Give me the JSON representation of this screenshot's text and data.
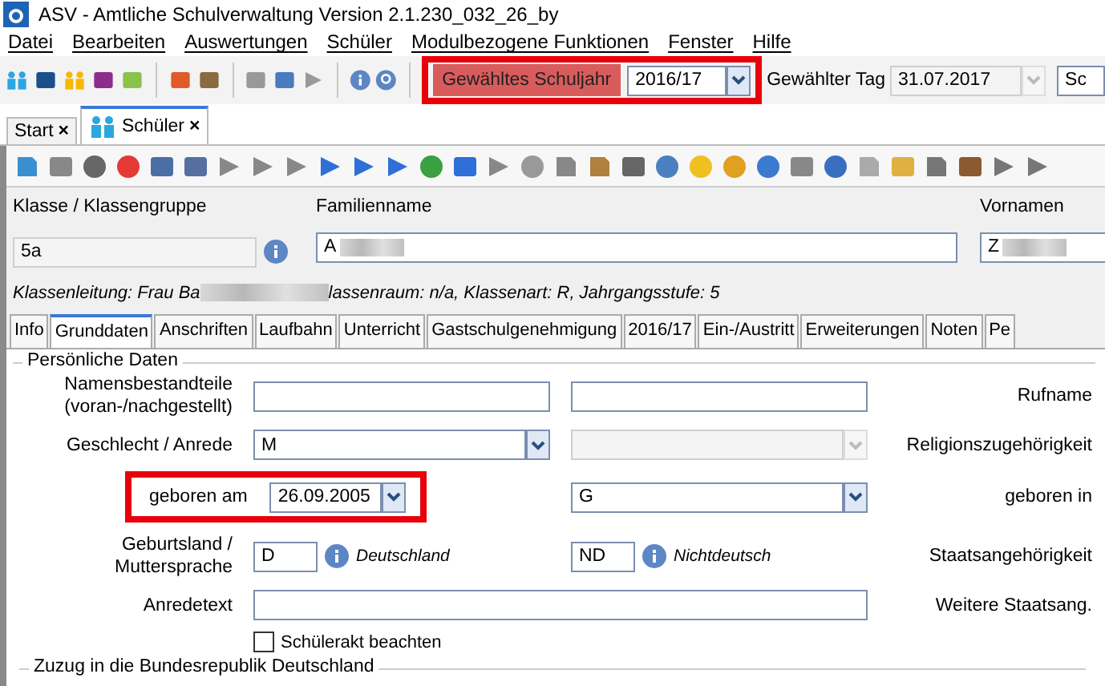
{
  "window": {
    "title": "ASV - Amtliche Schulverwaltung Version 2.1.230_032_26_by"
  },
  "menu": [
    "Datei",
    "Bearbeiten",
    "Auswertungen",
    "Schüler",
    "Modulbezogene Funktionen",
    "Fenster",
    "Hilfe"
  ],
  "toolbar": {
    "schuljahr_label": "Gewähltes Schuljahr",
    "schuljahr_value": "2016/17",
    "tag_label": "Gewählter Tag",
    "tag_value": "31.07.2017",
    "cut_field": "Sc"
  },
  "doc_tabs": [
    {
      "label": "Start",
      "close": "×",
      "selected": false
    },
    {
      "label": "Schüler",
      "close": "×",
      "selected": true
    }
  ],
  "header": {
    "klasse_label": "Klasse / Klassengruppe",
    "klasse_value": "5a",
    "familienname_label": "Familienname",
    "familienname_value": "A",
    "vornamen_label": "Vornamen",
    "vornamen_value": "Z",
    "info_before": "Klassenleitung: Frau Ba",
    "info_after": "lassenraum: n/a, Klassenart: R, Jahrgangsstufe: 5"
  },
  "detail_tabs": [
    {
      "label": "Info",
      "selected": false
    },
    {
      "label": "Grunddaten",
      "selected": true
    },
    {
      "label": "Anschriften",
      "selected": false
    },
    {
      "label": "Laufbahn",
      "selected": false
    },
    {
      "label": "Unterricht",
      "selected": false
    },
    {
      "label": "Gastschulgenehmigung",
      "selected": false
    },
    {
      "label": "2016/17",
      "selected": false
    },
    {
      "label": "Ein-/Austritt",
      "selected": false
    },
    {
      "label": "Erweiterungen",
      "selected": false
    },
    {
      "label": "Noten",
      "selected": false
    },
    {
      "label": "Pe",
      "selected": false
    }
  ],
  "section": {
    "title": "Persönliche Daten",
    "namensbestandteile_label": "Namensbestandteile\n(voran-/nachgestellt)",
    "rufname_label": "Rufname",
    "geschlecht_label": "Geschlecht / Anrede",
    "geschlecht_value": "M",
    "religion_label": "Religionszugehörigkeit",
    "religion_disabled": true,
    "geboren_am_label": "geboren am",
    "geboren_am_value": "26.09.2005",
    "geboren_in_value": "G",
    "geboren_in_label": "geboren in",
    "geburtsland_label": "Geburtsland /\nMuttersprache",
    "geburtsland_value": "D",
    "geburtsland_text": "Deutschland",
    "staat_value": "ND",
    "staat_text": "Nichtdeutsch",
    "staat_label": "Staatsangehörigkeit",
    "anredetext_label": "Anredetext",
    "weitere_label": "Weitere Staatsang.",
    "schuelerakt": {
      "label": "Schülerakt beachten",
      "checked": false
    }
  },
  "next_section": {
    "title": "Zuzug in die Bundesrepublik Deutschland"
  }
}
